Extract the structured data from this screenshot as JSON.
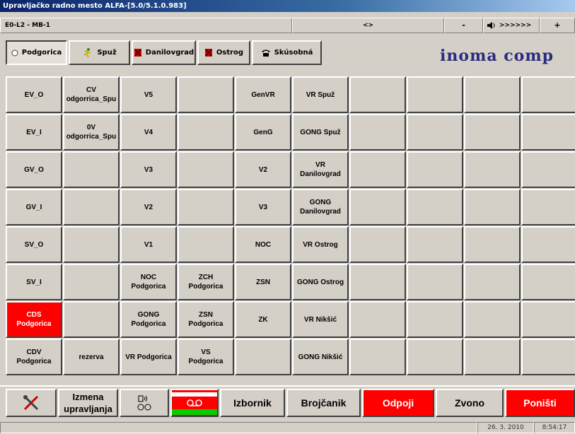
{
  "window": {
    "title": "Upravljačko radno mesto ALFA-[5.0/5.1.0.983]"
  },
  "infobar": {
    "station": "E0-L2 - MB-1",
    "indicator": "<>",
    "minus": "-",
    "volume": ">>>>>>",
    "plus": "+"
  },
  "stations": [
    {
      "label": "Podgorica",
      "icon": "radio-icon"
    },
    {
      "label": "Spuž",
      "icon": "walker-icon"
    },
    {
      "label": "Danilovgrad",
      "icon": "red-flag-icon"
    },
    {
      "label": "Ostrog",
      "icon": "red-flag-icon"
    },
    {
      "label": "Skúsobná",
      "icon": "telephone-icon"
    }
  ],
  "brand": "inoma comp",
  "grid": [
    [
      "EV_O",
      "CV\nodgorrica_Spu",
      "V5",
      "",
      "GenVR",
      "VR Spuž",
      "",
      "",
      "",
      ""
    ],
    [
      "EV_I",
      "0V\nodgorrica_Spu",
      "V4",
      "",
      "GenG",
      "GONG Spuž",
      "",
      "",
      "",
      ""
    ],
    [
      "GV_O",
      "",
      "V3",
      "",
      "V2",
      "VR\nDanilovgrad",
      "",
      "",
      "",
      ""
    ],
    [
      "GV_I",
      "",
      "V2",
      "",
      "V3",
      "GONG\nDanilovgrad",
      "",
      "",
      "",
      ""
    ],
    [
      "SV_O",
      "",
      "V1",
      "",
      "NOC",
      "VR Ostrog",
      "",
      "",
      "",
      ""
    ],
    [
      "SV_I",
      "",
      "NOC\nPodgorica",
      "ZCH\nPodgorica",
      "ZSN",
      "GONG Ostrog",
      "",
      "",
      "",
      ""
    ],
    [
      "CDS\nPodgorica",
      "",
      "GONG\nPodgorica",
      "ZSN\nPodgorica",
      "ZK",
      "VR Nikšić",
      "",
      "",
      "",
      ""
    ],
    [
      "CDV\nPodgorica",
      "rezerva",
      "VR Podgorica",
      "VS\nPodgorica",
      "",
      "GONG Nikšić",
      "",
      "",
      "",
      ""
    ]
  ],
  "bottom": {
    "izmena": "Izmena\nupravljanja",
    "izbornik": "Izbornik",
    "brojcanik": "Brojčanik",
    "odpoji": "Odpoji",
    "zvono": "Zvono",
    "ponisti": "Poništi"
  },
  "status": {
    "date": "26. 3. 2010",
    "time": "8:54:17"
  },
  "colors": {
    "active_red": "#ff0000",
    "brand": "#2a2a80"
  }
}
